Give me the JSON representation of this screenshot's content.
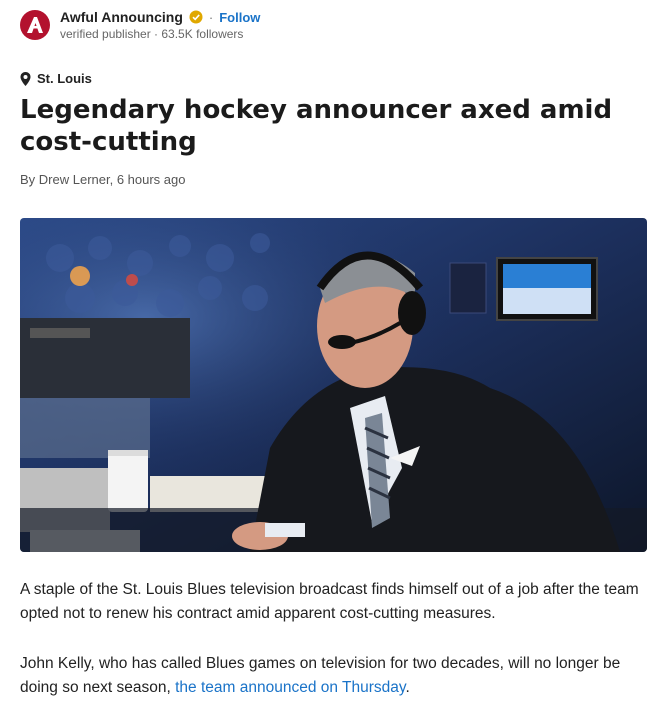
{
  "publisher": {
    "name": "Awful Announcing",
    "follow_label": "Follow",
    "separator": "·",
    "meta": "verified publisher · 63.5K followers",
    "brand_color": "#b3122e",
    "logo_icon": "aa-logo-icon",
    "verified_icon": "verified-badge-icon"
  },
  "article": {
    "location": "St. Louis",
    "title": "Legendary hockey announcer axed amid cost-cutting",
    "byline": "By Drew Lerner, 6 hours ago",
    "paragraph1": "A staple of the St. Louis Blues television broadcast finds himself out of a job after the team opted not to renew his contract amid apparent cost-cutting measures.",
    "paragraph2_text": "John Kelly, who has called Blues games on television for two decades, will no longer be doing so next season, ",
    "paragraph2_link": "the team announced on Thursday",
    "paragraph2_end": ".",
    "link_color": "#1a73c8"
  }
}
